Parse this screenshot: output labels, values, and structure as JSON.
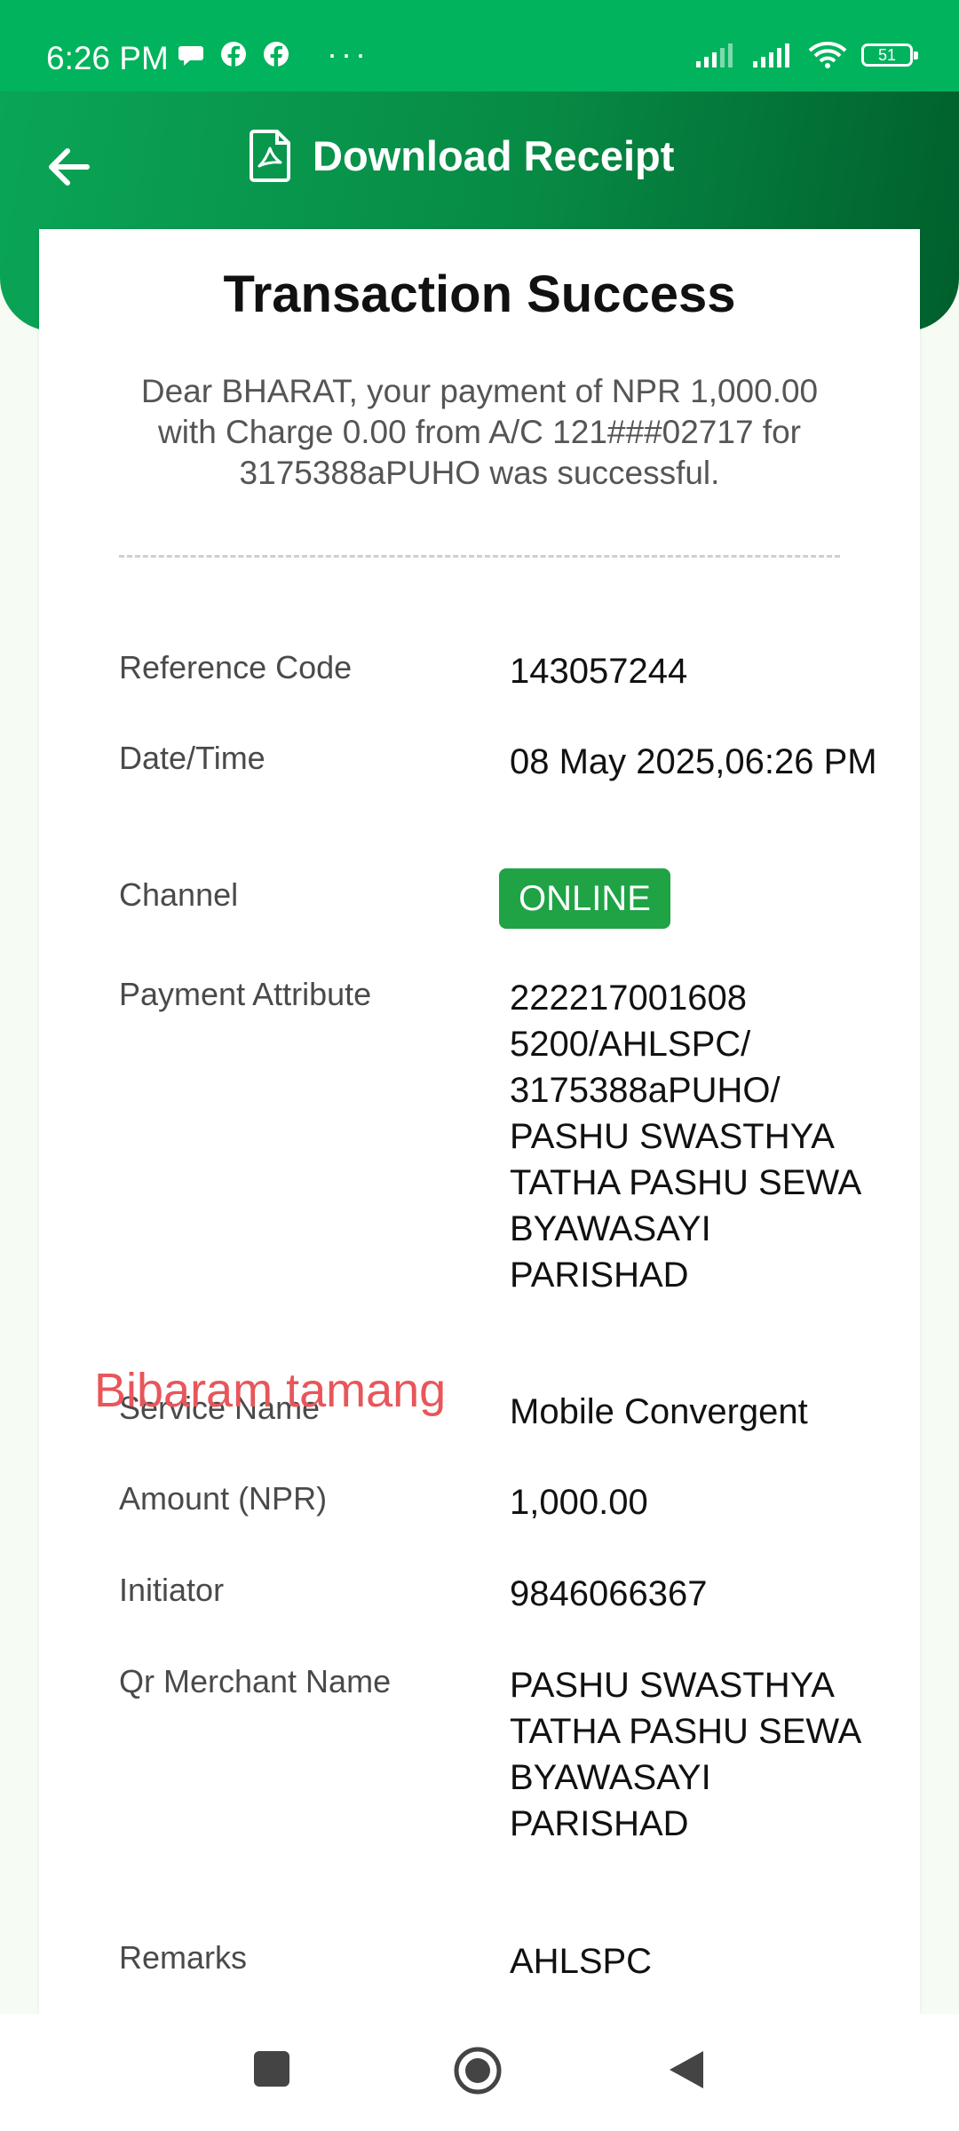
{
  "status_bar": {
    "time": "6:26 PM",
    "left_icons": [
      "chat-bubble-icon",
      "facebook-icon",
      "facebook-icon"
    ],
    "more": "···",
    "battery_level": "51"
  },
  "header": {
    "title": "Download Receipt"
  },
  "receipt": {
    "title": "Transaction Success",
    "message": "Dear BHARAT, your payment of NPR 1,000.00 with Charge 0.00 from A/C 121###02717 for 3175388aPUHO was successful.",
    "rows": [
      {
        "label": "Reference Code",
        "value": "143057244"
      },
      {
        "label": "Date/Time",
        "value": "08 May 2025,06:26 PM"
      },
      {
        "label": "Channel",
        "value": "ONLINE"
      },
      {
        "label": "Payment Attribute",
        "value": "222217001608 5200/AHLSPC/ 3175388aPUHO/ PASHU SWASTHYA TATHA PASHU SEWA BYAWASAYI PARISHAD"
      },
      {
        "label": "Service Name",
        "value": "Mobile Convergent"
      },
      {
        "label": "Amount (NPR)",
        "value": "1,000.00"
      },
      {
        "label": "Initiator",
        "value": "9846066367"
      },
      {
        "label": "Qr Merchant Name",
        "value": "PASHU SWASTHYA TATHA PASHU SEWA BYAWASAYI PARISHAD"
      },
      {
        "label": "Remarks",
        "value": "AHLSPC"
      }
    ],
    "watermark": "Bibaram tamang"
  },
  "colors": {
    "status_bar": "#00b35c",
    "header_start": "#0aa556",
    "header_end": "#005f2c",
    "badge": "#1fa345",
    "watermark": "#e8565a"
  }
}
